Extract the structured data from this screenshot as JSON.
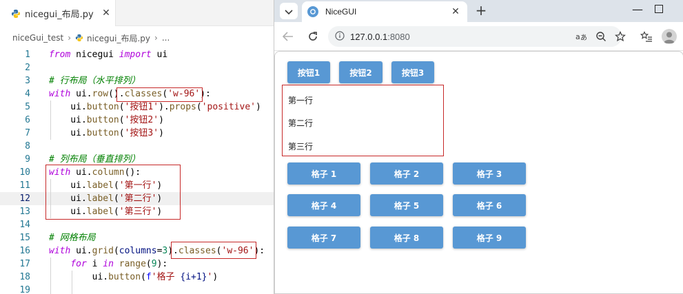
{
  "editor": {
    "tab_label": "nicegui_布局.py",
    "breadcrumb": [
      "niceGui_test",
      "nicegui_布局.py",
      "..."
    ],
    "active_line": 12,
    "lines": [
      {
        "n": "1",
        "tokens": [
          {
            "t": "from",
            "c": "kw"
          },
          {
            "t": " nicegui ",
            "c": ""
          },
          {
            "t": "import",
            "c": "kw"
          },
          {
            "t": " ui",
            "c": ""
          }
        ]
      },
      {
        "n": "2",
        "tokens": []
      },
      {
        "n": "3",
        "tokens": [
          {
            "t": "# 行布局（水平排列）",
            "c": "cmt"
          }
        ]
      },
      {
        "n": "4",
        "tokens": [
          {
            "t": "with",
            "c": "kw"
          },
          {
            "t": " ui.",
            "c": ""
          },
          {
            "t": "row",
            "c": "fn"
          },
          {
            "t": "()",
            "c": ""
          },
          {
            "t": ".",
            "c": ""
          },
          {
            "t": "classes",
            "c": "fn"
          },
          {
            "t": "(",
            "c": ""
          },
          {
            "t": "'w-96'",
            "c": "str"
          },
          {
            "t": "):",
            "c": ""
          }
        ]
      },
      {
        "n": "5",
        "tokens": [
          {
            "t": "    ui.",
            "c": ""
          },
          {
            "t": "button",
            "c": "fn"
          },
          {
            "t": "(",
            "c": ""
          },
          {
            "t": "'按钮1'",
            "c": "str"
          },
          {
            "t": ").",
            "c": ""
          },
          {
            "t": "props",
            "c": "fn"
          },
          {
            "t": "(",
            "c": ""
          },
          {
            "t": "'positive'",
            "c": "str"
          },
          {
            "t": ")",
            "c": ""
          }
        ]
      },
      {
        "n": "6",
        "tokens": [
          {
            "t": "    ui.",
            "c": ""
          },
          {
            "t": "button",
            "c": "fn"
          },
          {
            "t": "(",
            "c": ""
          },
          {
            "t": "'按钮2'",
            "c": "str"
          },
          {
            "t": ")",
            "c": ""
          }
        ]
      },
      {
        "n": "7",
        "tokens": [
          {
            "t": "    ui.",
            "c": ""
          },
          {
            "t": "button",
            "c": "fn"
          },
          {
            "t": "(",
            "c": ""
          },
          {
            "t": "'按钮3'",
            "c": "str"
          },
          {
            "t": ")",
            "c": ""
          }
        ]
      },
      {
        "n": "8",
        "tokens": []
      },
      {
        "n": "9",
        "tokens": [
          {
            "t": "# 列布局（垂直排列）",
            "c": "cmt"
          }
        ]
      },
      {
        "n": "10",
        "tokens": [
          {
            "t": "with",
            "c": "kw"
          },
          {
            "t": " ui.",
            "c": ""
          },
          {
            "t": "column",
            "c": "fn"
          },
          {
            "t": "():",
            "c": ""
          }
        ]
      },
      {
        "n": "11",
        "tokens": [
          {
            "t": "    ui.",
            "c": ""
          },
          {
            "t": "label",
            "c": "fn"
          },
          {
            "t": "(",
            "c": ""
          },
          {
            "t": "'第一行'",
            "c": "str"
          },
          {
            "t": ")",
            "c": ""
          }
        ]
      },
      {
        "n": "12",
        "tokens": [
          {
            "t": "    ui.",
            "c": ""
          },
          {
            "t": "label",
            "c": "fn"
          },
          {
            "t": "(",
            "c": ""
          },
          {
            "t": "'第二行'",
            "c": "str"
          },
          {
            "t": ")",
            "c": ""
          }
        ]
      },
      {
        "n": "13",
        "tokens": [
          {
            "t": "    ui.",
            "c": ""
          },
          {
            "t": "label",
            "c": "fn"
          },
          {
            "t": "(",
            "c": ""
          },
          {
            "t": "'第三行'",
            "c": "str"
          },
          {
            "t": ")",
            "c": ""
          }
        ]
      },
      {
        "n": "14",
        "tokens": []
      },
      {
        "n": "15",
        "tokens": [
          {
            "t": "# 网格布局",
            "c": "cmt"
          }
        ]
      },
      {
        "n": "16",
        "tokens": [
          {
            "t": "with",
            "c": "kw"
          },
          {
            "t": " ui.",
            "c": ""
          },
          {
            "t": "grid",
            "c": "fn"
          },
          {
            "t": "(",
            "c": ""
          },
          {
            "t": "columns",
            "c": "fn2"
          },
          {
            "t": "=",
            "c": ""
          },
          {
            "t": "3",
            "c": "num"
          },
          {
            "t": ")",
            "c": ""
          },
          {
            "t": ".",
            "c": ""
          },
          {
            "t": "classes",
            "c": "fn"
          },
          {
            "t": "(",
            "c": ""
          },
          {
            "t": "'w-96'",
            "c": "str"
          },
          {
            "t": "):",
            "c": ""
          }
        ]
      },
      {
        "n": "17",
        "tokens": [
          {
            "t": "    ",
            "c": ""
          },
          {
            "t": "for",
            "c": "kw"
          },
          {
            "t": " i ",
            "c": ""
          },
          {
            "t": "in",
            "c": "kw"
          },
          {
            "t": " ",
            "c": ""
          },
          {
            "t": "range",
            "c": "fn"
          },
          {
            "t": "(",
            "c": ""
          },
          {
            "t": "9",
            "c": "num"
          },
          {
            "t": "):",
            "c": ""
          }
        ]
      },
      {
        "n": "18",
        "tokens": [
          {
            "t": "        ui.",
            "c": ""
          },
          {
            "t": "button",
            "c": "fn"
          },
          {
            "t": "(",
            "c": ""
          },
          {
            "t": "f",
            "c": "kw2"
          },
          {
            "t": "'格子 ",
            "c": "str"
          },
          {
            "t": "{i+1}",
            "c": "fn2"
          },
          {
            "t": "'",
            "c": "str"
          },
          {
            "t": ")",
            "c": ""
          }
        ]
      },
      {
        "n": "19",
        "tokens": []
      }
    ]
  },
  "browser": {
    "tab_title": "NiceGUI",
    "url_host": "127.0.0.1",
    "url_port": ":8080",
    "new_tab": "+",
    "close": "✕",
    "minimize": "—"
  },
  "page": {
    "row_buttons": [
      "按钮1",
      "按钮2",
      "按钮3"
    ],
    "column_labels": [
      "第一行",
      "第二行",
      "第三行"
    ],
    "grid_buttons": [
      "格子 1",
      "格子 2",
      "格子 3",
      "格子 4",
      "格子 5",
      "格子 6",
      "格子 7",
      "格子 8",
      "格子 9"
    ]
  },
  "colors": {
    "button": "#5898d4",
    "highlight_box": "#c62828"
  }
}
